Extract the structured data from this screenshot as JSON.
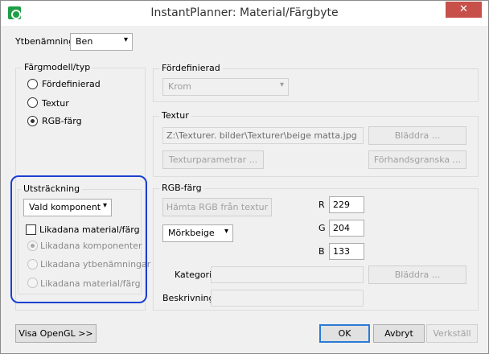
{
  "window": {
    "title": "InstantPlanner: Material/Färgbyte",
    "close_glyph": "✕"
  },
  "ytbenamning": {
    "label": "Ytbenämning",
    "value": "Ben"
  },
  "fargmodell": {
    "title": "Färgmodell/typ",
    "options": [
      "Fördefinierad",
      "Textur",
      "RGB-färg"
    ],
    "selected": "RGB-färg"
  },
  "fordefinierad": {
    "title": "Fördefinierad",
    "value": "Krom"
  },
  "textur": {
    "title": "Textur",
    "path": "Z:\\Texturer. bilder\\Texturer\\beige matta.jpg",
    "browse_label": "Bläddra ...",
    "params_label": "Texturparametrar ...",
    "preview_label": "Förhandsgranska ..."
  },
  "utstrackning": {
    "title": "Utsträckning",
    "value": "Vald komponent",
    "checkbox_label": "Likadana material/färg",
    "options": [
      "Likadana komponenter",
      "Likadana ytbenämningar",
      "Likadana material/färg"
    ]
  },
  "rgb": {
    "title": "RGB-färg",
    "fetch_label": "Hämta RGB från textur",
    "preset": "Mörkbeige",
    "r_label": "R",
    "r": "229",
    "g_label": "G",
    "g": "204",
    "b_label": "B",
    "b": "133",
    "kategori_label": "Kategori",
    "browse_label": "Bläddra ...",
    "beskrivning_label": "Beskrivning"
  },
  "footer": {
    "opengl_label": "Visa OpenGL >>",
    "ok_label": "OK",
    "cancel_label": "Avbryt",
    "apply_label": "Verkställ"
  },
  "icons": {
    "arrow": "▾"
  },
  "colors": {
    "accent": "#2a7bd6",
    "highlight": "#1c3fd1",
    "close": "#c7504a"
  }
}
